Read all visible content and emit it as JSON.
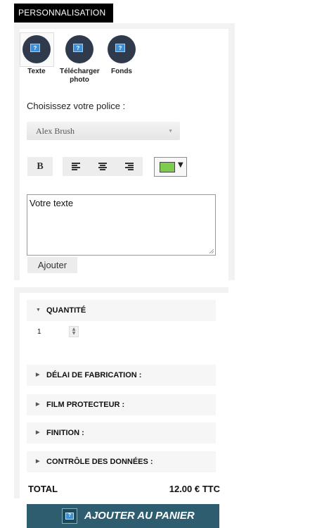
{
  "header": {
    "title": "PERSONNALISATION"
  },
  "tools": [
    {
      "label": "Texte",
      "icon": "question-image-icon"
    },
    {
      "label": "Télécharger photo",
      "icon": "question-image-icon"
    },
    {
      "label": "Fonds",
      "icon": "question-image-icon"
    }
  ],
  "icon_glyph": "?",
  "font_section": {
    "label": "Choisissez votre police :",
    "selected_font": "Alex Brush"
  },
  "formatting": {
    "bold_label": "B",
    "text_color": "#7dcc4e"
  },
  "text_input": {
    "value": "Votre texte"
  },
  "add_button": {
    "label": "Ajouter"
  },
  "options": {
    "quantity": {
      "label": "QUANTITÉ",
      "value": "1",
      "expanded": true
    },
    "rows": [
      {
        "label": "DÉLAI DE FABRICATION :"
      },
      {
        "label": "FILM PROTECTEUR :"
      },
      {
        "label": "FINITION :"
      },
      {
        "label": "CONTRÔLE DES DONNÉES :"
      }
    ]
  },
  "total": {
    "label": "TOTAL",
    "value": "12.00 € TTC"
  },
  "cart_button": {
    "label": "AJOUTER AU PANIER"
  },
  "colors": {
    "cart_button_bg": "#2d5d6e",
    "tool_circle": "#2f3a4d"
  }
}
